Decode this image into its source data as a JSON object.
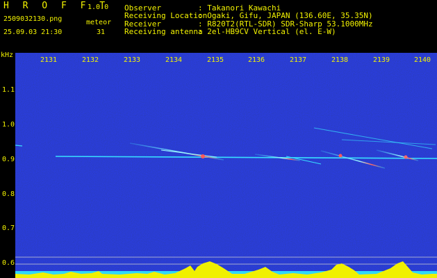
{
  "header": {
    "app_title": "H R O F F T",
    "version": "1.0.0",
    "filename": "2509032130.png",
    "meteor_label": "meteor",
    "datetime": "25.09.03 21:30",
    "meteor_count": "31",
    "rows": [
      {
        "label": "Observer",
        "value": ": Takanori Kawachi"
      },
      {
        "label": "Receiving Location",
        "value": ": Ogaki, Gifu, JAPAN (136.60E, 35.35N)"
      },
      {
        "label": "Receiver",
        "value": ": R820T2(RTL-SDR) SDR-Sharp 53.1000MHz"
      },
      {
        "label": "Receiving antenna",
        "value": ": 2el-HB9CV Vertical (el. E-W)"
      }
    ]
  },
  "axes": {
    "y_unit": "kHz",
    "x_ticks": [
      "2131",
      "2132",
      "2133",
      "2134",
      "2135",
      "2136",
      "2137",
      "2138",
      "2139",
      "2140"
    ],
    "y_ticks": [
      "1.1",
      "1.0",
      "0.9",
      "0.8",
      "0.7",
      "0.6"
    ]
  },
  "colors": {
    "background_noise": "#08127a",
    "trace": "#38e0ff",
    "text": "#f4f400",
    "header_text": "#e8e8e8",
    "level_bar": "#f0f000",
    "level_base": "#30d8f8"
  }
}
